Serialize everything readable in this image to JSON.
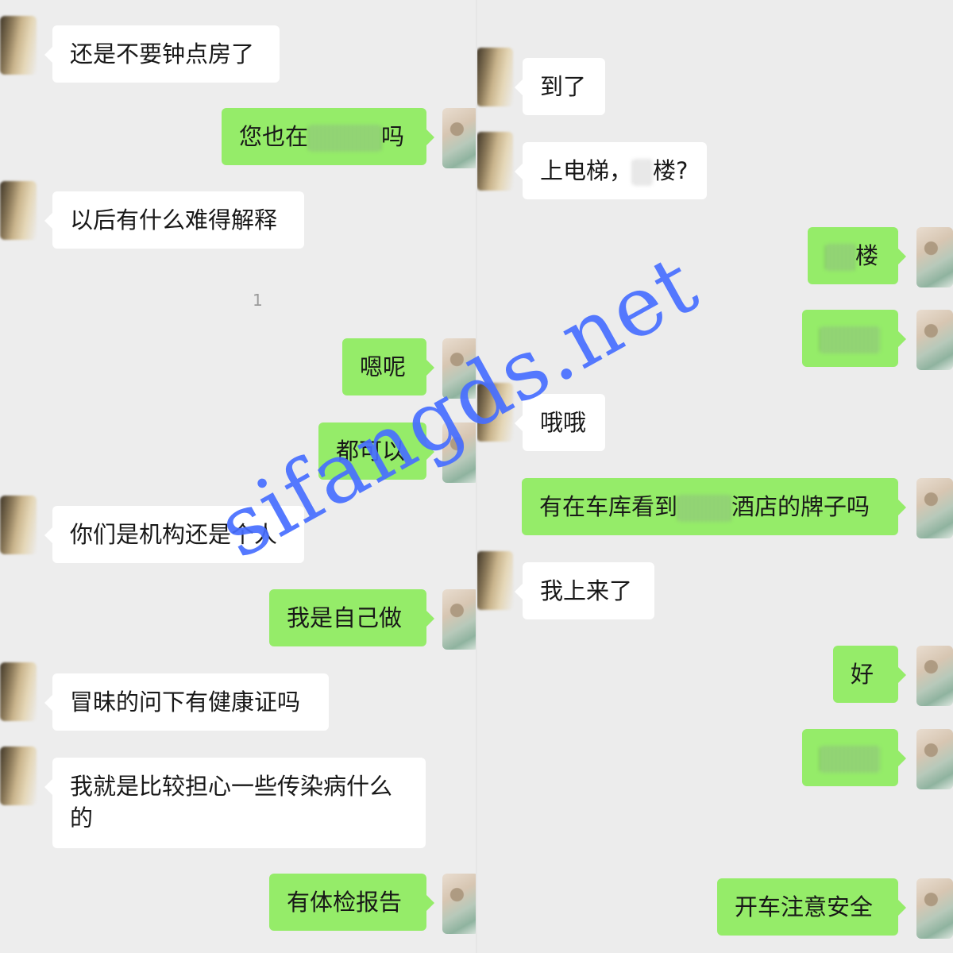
{
  "left_panel": {
    "messages": [
      {
        "from": "peer",
        "text": "还是不要钟点房了"
      },
      {
        "from": "self",
        "text_before": "您也在",
        "text_after": "吗"
      },
      {
        "from": "peer",
        "text": "以后有什么难得解释"
      },
      {
        "from": "self",
        "text": "嗯呢"
      },
      {
        "from": "self",
        "text": "都可以"
      },
      {
        "from": "peer",
        "text": "你们是机构还是个人"
      },
      {
        "from": "self",
        "text": "我是自己做"
      },
      {
        "from": "peer",
        "text": "冒昧的问下有健康证吗"
      },
      {
        "from": "peer",
        "text": "我就是比较担心一些传染病什么的"
      },
      {
        "from": "self",
        "text": "有体检报告"
      }
    ],
    "faint_mark": "1"
  },
  "right_panel": {
    "messages": [
      {
        "from": "peer",
        "text": "到了"
      },
      {
        "from": "peer",
        "text_before": "上电梯，",
        "text_after": "楼?"
      },
      {
        "from": "self",
        "text_after": "楼"
      },
      {
        "from": "self",
        "text": ""
      },
      {
        "from": "peer",
        "text": "哦哦"
      },
      {
        "from": "self",
        "text_before": "有在车库看到",
        "text_after": "酒店的牌子吗"
      },
      {
        "from": "peer",
        "text": "我上来了"
      },
      {
        "from": "self",
        "text": "好"
      },
      {
        "from": "self",
        "text": ""
      },
      {
        "from": "self",
        "text": "开车注意安全"
      }
    ]
  },
  "watermark": "sifangds.net",
  "colors": {
    "background": "#ededed",
    "incoming_bubble": "#ffffff",
    "outgoing_bubble": "#95ec69",
    "watermark": "#466eff"
  }
}
